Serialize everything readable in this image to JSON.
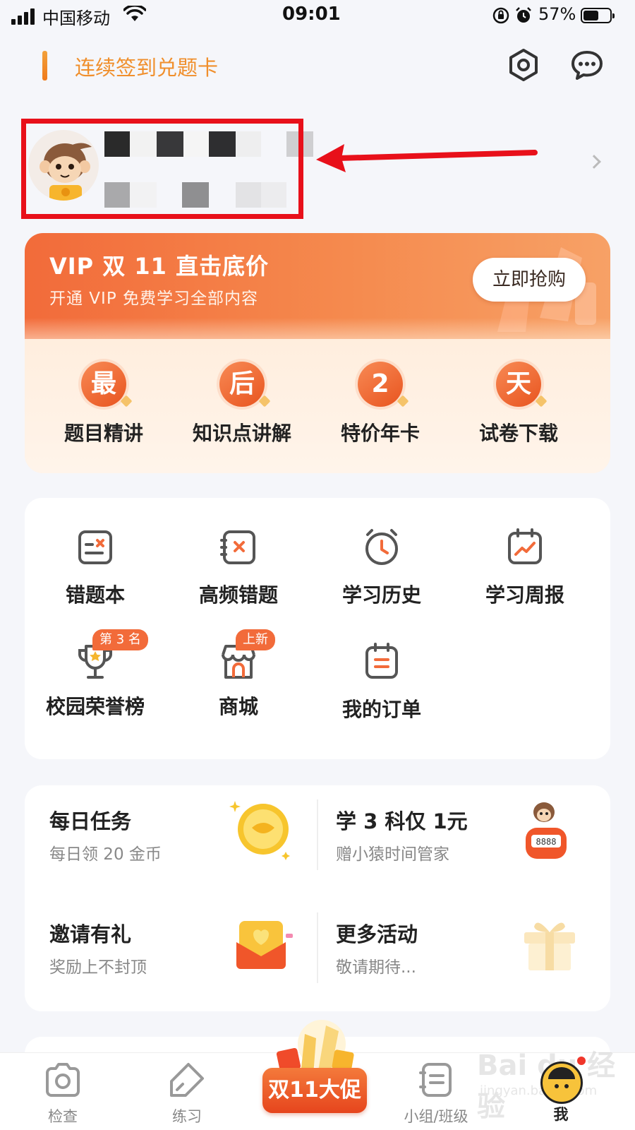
{
  "status_bar": {
    "carrier": "中国移动",
    "time": "09:01",
    "battery_percent": "57%",
    "battery_level": 0.57
  },
  "header": {
    "signin_text": "连续签到兑题卡",
    "settings_icon": "hexagon-settings-icon",
    "message_icon": "chat-bubble-icon"
  },
  "profile": {
    "avatar_icon": "monkey-avatar-icon",
    "highlight_color": "#e8101a"
  },
  "vip": {
    "title": "VIP 双 11 直击底价",
    "subtitle": "开通 VIP 免费学习全部内容",
    "button": "立即抢购",
    "items": [
      {
        "badge": "最",
        "label": "题目精讲"
      },
      {
        "badge": "后",
        "label": "知识点讲解"
      },
      {
        "badge": "2",
        "label": "特价年卡"
      },
      {
        "badge": "天",
        "label": "试卷下载"
      }
    ]
  },
  "tools": {
    "items": [
      {
        "label": "错题本",
        "icon": "mistake-book-icon"
      },
      {
        "label": "高频错题",
        "icon": "frequent-mistakes-icon"
      },
      {
        "label": "学习历史",
        "icon": "alarm-clock-icon"
      },
      {
        "label": "学习周报",
        "icon": "weekly-report-icon"
      },
      {
        "label": "校园荣誉榜",
        "icon": "trophy-icon",
        "tag": "第 3 名"
      },
      {
        "label": "商城",
        "icon": "shop-icon",
        "tag": "上新"
      },
      {
        "label": "我的订单",
        "icon": "order-icon"
      }
    ]
  },
  "activities": [
    {
      "title": "每日任务",
      "subtitle": "每日领 20 金币",
      "icon": "gold-coin-icon"
    },
    {
      "title": "学 3 科仅 1元",
      "subtitle": "赠小猿时间管家",
      "icon": "timer-monkey-icon"
    },
    {
      "title": "邀请有礼",
      "subtitle": "奖励上不封顶",
      "icon": "red-envelope-icon"
    },
    {
      "title": "更多活动",
      "subtitle": "敬请期待...",
      "icon": "gift-box-icon"
    }
  ],
  "tabbar": {
    "tabs": [
      {
        "label": "检查",
        "icon": "camera-icon"
      },
      {
        "label": "练习",
        "icon": "pencil-tag-icon"
      },
      {
        "label": "双11大促",
        "icon": "promo-icon"
      },
      {
        "label": "小组/班级",
        "icon": "group-list-icon"
      },
      {
        "label": "我",
        "icon": "me-avatar-icon"
      }
    ]
  },
  "watermark": {
    "line1": "Bai du 经验",
    "line2": "jingyan.baidu.com"
  },
  "colors": {
    "accent_orange": "#f26b3a",
    "signin_orange": "#f08f2c",
    "page_bg": "#f5f6fa"
  }
}
